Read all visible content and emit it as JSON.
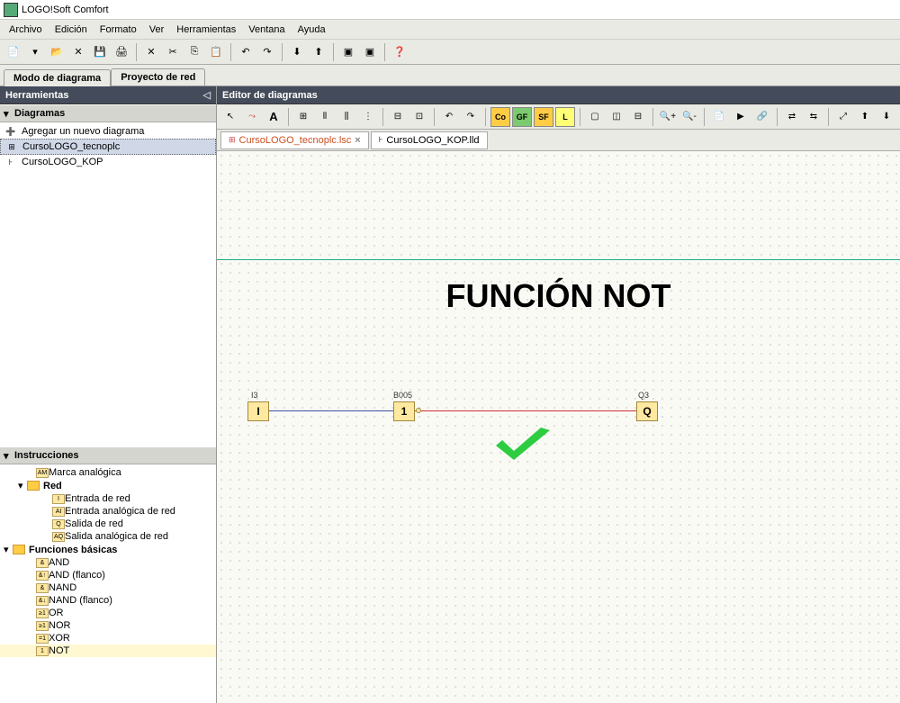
{
  "app": {
    "title": "LOGO!Soft Comfort"
  },
  "menu": {
    "archivo": "Archivo",
    "edicion": "Edición",
    "formato": "Formato",
    "ver": "Ver",
    "herramientas": "Herramientas",
    "ventana": "Ventana",
    "ayuda": "Ayuda"
  },
  "mode_tabs": {
    "diagram": "Modo de diagrama",
    "network": "Proyecto de red"
  },
  "sidebar": {
    "tools_hdr": "Herramientas",
    "diagrams_hdr": "Diagramas",
    "instructions_hdr": "Instrucciones",
    "add_diagram": "Agregar un nuevo diagrama",
    "diagram1": "CursoLOGO_tecnoplc",
    "diagram2": "CursoLOGO_KOP",
    "marca_analogica": "Marca analógica",
    "red": "Red",
    "entrada_red": "Entrada de red",
    "entrada_analog_red": "Entrada analógica de red",
    "salida_red": "Salida de red",
    "salida_analog_red": "Salida analógica de red",
    "funciones_basicas": "Funciones básicas",
    "and": "AND",
    "and_flanco": "AND (flanco)",
    "nand": "NAND",
    "nand_flanco": "NAND (flanco)",
    "or": "OR",
    "nor": "NOR",
    "xor": "XOR",
    "not": "NOT"
  },
  "editor": {
    "hdr": "Editor de diagramas",
    "tab1": "CursoLOGO_tecnoplc.lsc",
    "tab2": "CursoLOGO_KOP.lld",
    "co": "Co",
    "gf": "GF",
    "sf": "SF",
    "fl": "L"
  },
  "canvas": {
    "title": "FUNCIÓN NOT",
    "i3_label": "I3",
    "i3": "I",
    "b005_label": "B005",
    "b005": "1",
    "q3_label": "Q3",
    "q3": "Q"
  }
}
